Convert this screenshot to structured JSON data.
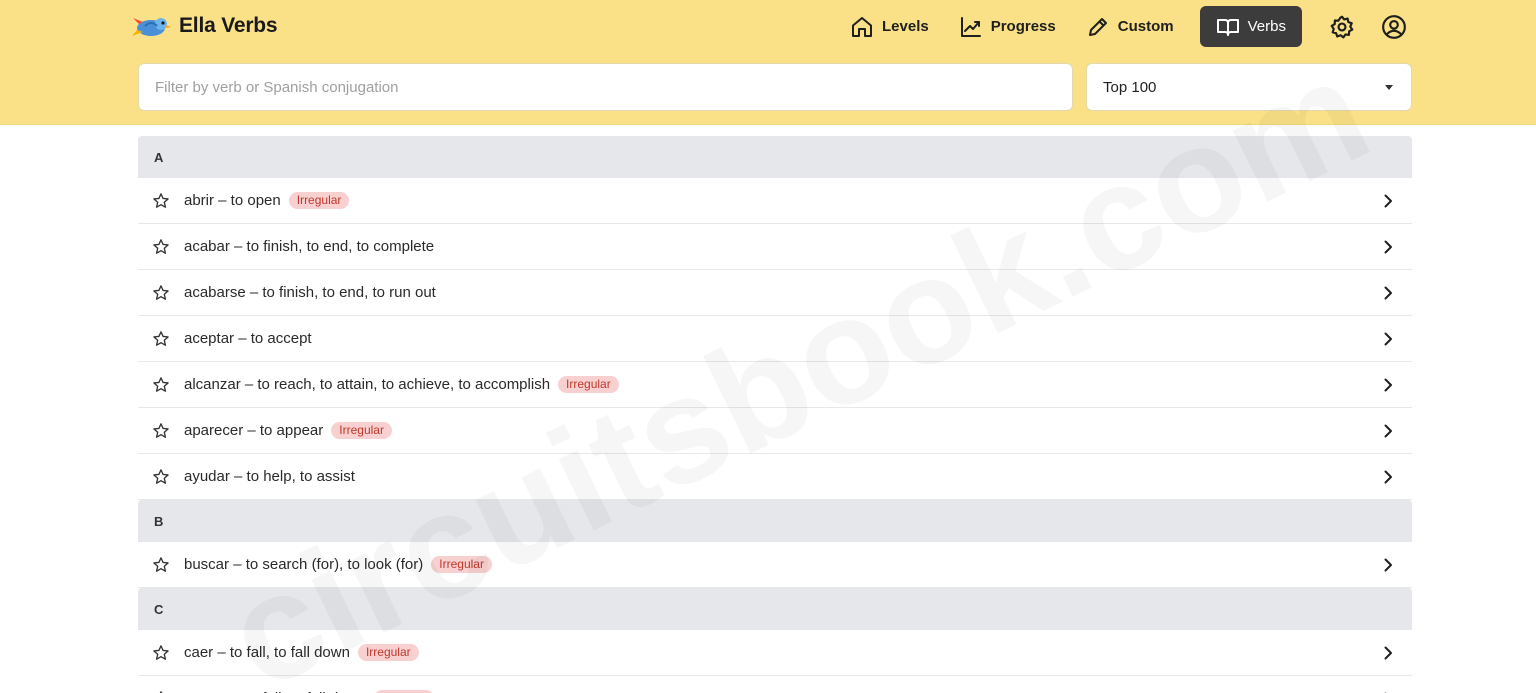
{
  "app": {
    "name": "Ella Verbs",
    "logo_icon": "parrot-logo-icon"
  },
  "nav": {
    "items": [
      {
        "label": "Levels",
        "icon": "home-icon"
      },
      {
        "label": "Progress",
        "icon": "trend-chart-icon"
      },
      {
        "label": "Custom",
        "icon": "pencil-icon"
      },
      {
        "label": "Verbs",
        "icon": "book-icon",
        "active": true
      }
    ],
    "settings_icon": "gear-icon",
    "account_icon": "user-circle-icon"
  },
  "filter": {
    "search_placeholder": "Filter by verb or Spanish conjugation",
    "search_value": "",
    "select_value": "Top 100"
  },
  "sections": [
    {
      "letter": "A",
      "verbs": [
        {
          "text": "abrir – to open",
          "badge": "Irregular"
        },
        {
          "text": "acabar – to finish, to end, to complete",
          "badge": ""
        },
        {
          "text": "acabarse – to finish, to end, to run out",
          "badge": ""
        },
        {
          "text": "aceptar – to accept",
          "badge": ""
        },
        {
          "text": "alcanzar – to reach, to attain, to achieve, to accomplish",
          "badge": "Irregular"
        },
        {
          "text": "aparecer – to appear",
          "badge": "Irregular"
        },
        {
          "text": "ayudar – to help, to assist",
          "badge": ""
        }
      ]
    },
    {
      "letter": "B",
      "verbs": [
        {
          "text": "buscar – to search (for), to look (for)",
          "badge": "Irregular"
        }
      ]
    },
    {
      "letter": "C",
      "verbs": [
        {
          "text": "caer – to fall, to fall down",
          "badge": "Irregular"
        },
        {
          "text": "caerse – to fall, to fall down",
          "badge": "Irregular"
        }
      ]
    }
  ],
  "watermark": "circuitsbook.com",
  "colors": {
    "header_bg": "#fae187",
    "active_nav_bg": "#3c3c3c",
    "section_bg": "#e5e7eb",
    "badge_bg": "#f8d0d0",
    "badge_text": "#c0392b"
  }
}
